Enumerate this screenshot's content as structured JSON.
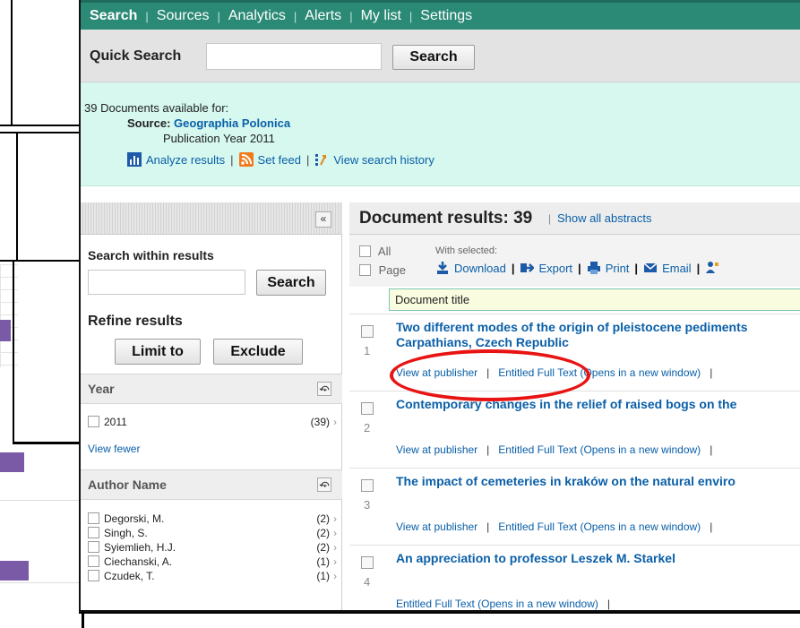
{
  "nav": {
    "items": [
      {
        "label": "Search",
        "active": true
      },
      {
        "label": "Sources",
        "active": false
      },
      {
        "label": "Analytics",
        "active": false
      },
      {
        "label": "Alerts",
        "active": false
      },
      {
        "label": "My list",
        "active": false
      },
      {
        "label": "Settings",
        "active": false
      }
    ],
    "separator": "|"
  },
  "quick_search": {
    "label": "Quick Search",
    "value": "",
    "button": "Search"
  },
  "info": {
    "count_text": "39 Documents available for:",
    "source_label": "Source:",
    "source_value": "Geographia Polonica",
    "year_text": "Publication Year 2011",
    "analyze": "Analyze results",
    "set_feed": "Set feed",
    "history": "View search history"
  },
  "sidebar": {
    "collapse": "«",
    "search_within_label": "Search within results",
    "search_within_value": "",
    "search_button": "Search",
    "refine_label": "Refine results",
    "limit_button": "Limit to",
    "exclude_button": "Exclude",
    "year": {
      "title": "Year",
      "items": [
        {
          "label": "2011",
          "count": "(39)"
        }
      ],
      "view_fewer": "View fewer"
    },
    "author": {
      "title": "Author Name",
      "items": [
        {
          "label": "Degorski, M.",
          "count": "(2)"
        },
        {
          "label": "Singh, S.",
          "count": "(2)"
        },
        {
          "label": "Syiemlieh, H.J.",
          "count": "(2)"
        },
        {
          "label": "Ciechanski, A.",
          "count": "(1)"
        },
        {
          "label": "Czudek, T.",
          "count": "(1)"
        }
      ]
    },
    "toggle": "⤽"
  },
  "results": {
    "title": "Document results: 39",
    "show_abstracts": "Show all abstracts",
    "all_label": "All",
    "page_label": "Page",
    "with_selected": "With selected:",
    "tools": {
      "download": "Download",
      "export": "Export",
      "print": "Print",
      "email": "Email"
    },
    "column": "Document title",
    "docs": [
      {
        "num": "1",
        "title": "Two different modes of the origin of pleistocene pediments",
        "title2": "Carpathians, Czech Republic",
        "publisher": "View at publisher",
        "fulltext": "Entitled Full Text (Opens in a new window)"
      },
      {
        "num": "2",
        "title": "Contemporary changes in the relief of raised bogs on the",
        "title2": "",
        "publisher": "View at publisher",
        "fulltext": "Entitled Full Text (Opens in a new window)"
      },
      {
        "num": "3",
        "title": "The impact of cemeteries in kraków on the natural enviro",
        "title2": "",
        "publisher": "View at publisher",
        "fulltext": "Entitled Full Text (Opens in a new window)"
      },
      {
        "num": "4",
        "title": "An appreciation to professor Leszek M. Starkel",
        "title2": "",
        "publisher": "",
        "fulltext": "Entitled Full Text (Opens in a new window)"
      }
    ]
  },
  "colors": {
    "nav": "#2b8a76",
    "info_bg": "#d6f8ef",
    "link": "#0a5fa8",
    "highlight": "#e81414"
  }
}
